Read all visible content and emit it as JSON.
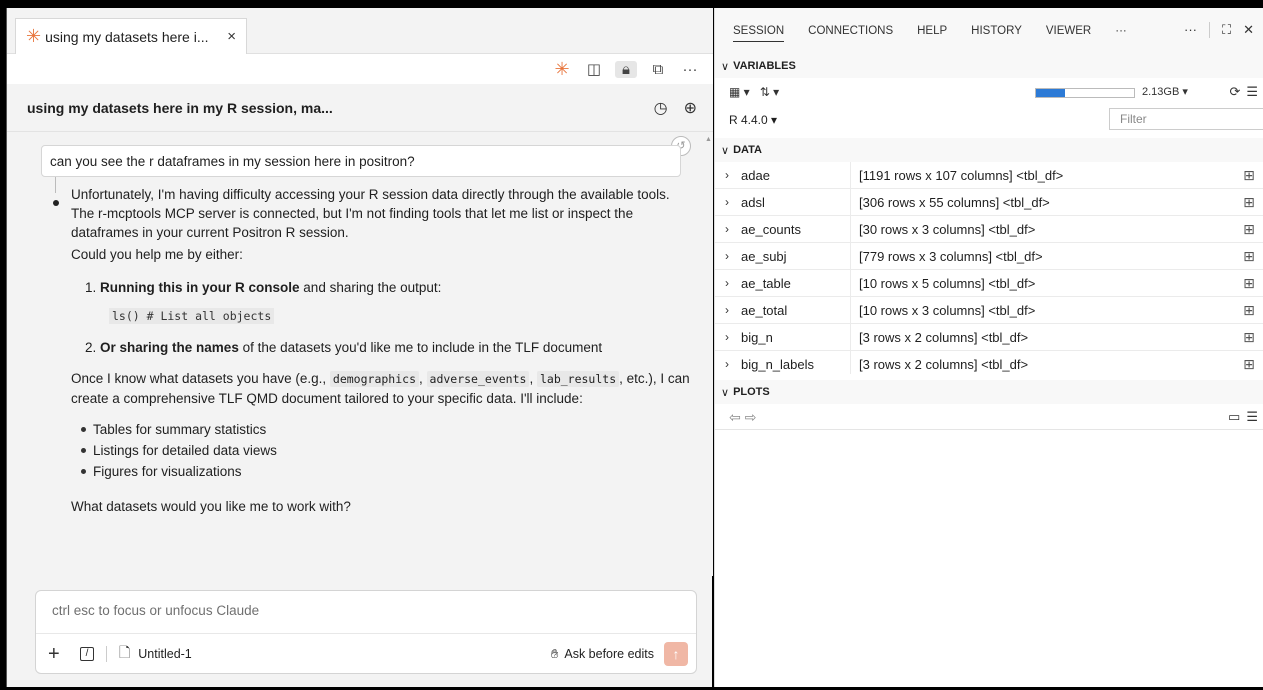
{
  "editor_tab": {
    "title": "using my datasets here i...",
    "close": "×"
  },
  "conversation": {
    "title": "using my datasets here in my R session, ma...",
    "user_message": "can you see the r dataframes in my session here in positron?",
    "p1": "Unfortunately, I'm having difficulty accessing your R session data directly through the available tools. The r-mcptools MCP server is connected, but I'm not finding tools that let me list or inspect the dataframes in your current Positron R session.",
    "p2": "Could you help me by either:",
    "item1_num": "1.",
    "item1_bold": "Running this in your R console",
    "item1_rest": " and sharing the output:",
    "code": "ls()  # List all objects",
    "item2_num": "2.",
    "item2_bold": "Or sharing the names",
    "item2_rest": " of the datasets you'd like me to include in the TLF document",
    "p3_start": "Once I know what datasets you have (e.g., ",
    "code1": "demographics",
    "comma1": ", ",
    "code2": "adverse_events",
    "comma2": ", ",
    "code3": "lab_results",
    "p3_end": ", etc.), I can create a comprehensive TLF QMD document tailored to your specific data. I'll include:",
    "bullets": [
      "Tables for summary statistics",
      "Listings for detailed data views",
      "Figures for visualizations"
    ],
    "p4": "What datasets would you like me to work with?"
  },
  "input": {
    "placeholder": "ctrl esc to focus or unfocus Claude",
    "file": "Untitled-1",
    "mode": "Ask before edits"
  },
  "right_tabs": [
    "SESSION",
    "CONNECTIONS",
    "HELP",
    "HISTORY",
    "VIEWER",
    "···"
  ],
  "variables": {
    "header": "VARIABLES",
    "memory_label": "2.13GB ▾",
    "memory_fraction": 0.3,
    "r_version": "R 4.4.0 ▾",
    "filter_placeholder": "Filter",
    "data_header": "DATA",
    "rows": [
      {
        "name": "adae",
        "value": "[1191 rows x 107 columns] <tbl_df>"
      },
      {
        "name": "adsl",
        "value": "[306 rows x 55 columns] <tbl_df>"
      },
      {
        "name": "ae_counts",
        "value": "[30 rows x 3 columns] <tbl_df>"
      },
      {
        "name": "ae_subj",
        "value": "[779 rows x 3 columns] <tbl_df>"
      },
      {
        "name": "ae_table",
        "value": "[10 rows x 5 columns] <tbl_df>"
      },
      {
        "name": "ae_total",
        "value": "[10 rows x 3 columns] <tbl_df>"
      },
      {
        "name": "big_n",
        "value": "[3 rows x 2 columns] <tbl_df>"
      },
      {
        "name": "big_n_labels",
        "value": "[3 rows x 2 columns] <tbl_df>"
      }
    ]
  },
  "plots": {
    "header": "PLOTS"
  }
}
